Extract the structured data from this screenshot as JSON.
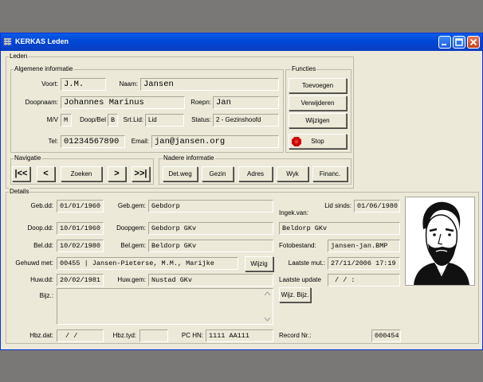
{
  "window": {
    "title": "KERKAS Leden"
  },
  "leden": {
    "group_label": "Leden",
    "algemeen": {
      "group_label": "Algemene informatie",
      "voort_label": "Voort:",
      "voort": "J.M.",
      "naam_label": "Naam:",
      "naam": "Jansen",
      "doopnaam_label": "Doopnaam:",
      "doopnaam": "Johannes Marinus",
      "roepn_label": "Roepn:",
      "roepn": "Jan",
      "mv_label": "M/V",
      "mv": "M",
      "doopbel_label": "Doop/Bel",
      "doopbel": "B",
      "srtlid_label": "Srt.Lid:",
      "srtlid": "Lid",
      "status_label": "Status:",
      "status": "2 - Gezinshoofd",
      "tel_label": "Tel:",
      "tel": "01234567890",
      "email_label": "Email:",
      "email": "jan@jansen.org"
    },
    "functies": {
      "group_label": "Functies",
      "toevoegen": "Toevoegen",
      "verwijderen": "Verwijderen",
      "wijzigen": "Wijzigen",
      "stop": "Stop"
    },
    "navigatie": {
      "group_label": "Navigatie",
      "first": "|<<",
      "prev": "<",
      "zoeken": "Zoeken",
      "next": ">",
      "last": ">>|"
    },
    "nadere": {
      "group_label": "Nadere informatie",
      "buttons": [
        "Det.weg",
        "Gezin",
        "Adres",
        "Wyk",
        "Financ."
      ]
    }
  },
  "details": {
    "group_label": "Details",
    "gebdd_label": "Geb.dd:",
    "gebdd": "01/01/1960",
    "gebgem_label": "Geb.gem:",
    "gebgem": "Gebdorp",
    "ingekvan_label": "Ingek.van:",
    "lidsinds_label": "Lid sinds:",
    "lidsinds": "01/06/1980",
    "doopdd_label": "Doop.dd:",
    "doopdd": "10/01/1960",
    "doopgem_label": "Doopgem:",
    "doopgem": "Gebdorp GKv",
    "ingekvan": "Beldorp GKv",
    "beldd_label": "Bel.dd:",
    "beldd": "10/02/1980",
    "belgem_label": "Bel.gem:",
    "belgem": "Beldorp GKv",
    "fotobestand_label": "Fotobestand:",
    "fotobestand": "jansen-jan.BMP",
    "gehuwd_label": "Gehuwd met:",
    "gehuwd": "00455 | Jansen-Pieterse, M.M., Marijke",
    "wijzig": "Wijzig",
    "laatstemut_label": "Laatste mut.:",
    "laatstemut": "27/11/2006 17:19",
    "huwdd_label": "Huw.dd:",
    "huwdd": "20/02/1981",
    "huwgem_label": "Huw.gem:",
    "huwgem": "Nustad GKv",
    "laatsteupdate_label": "Laatste update",
    "laatsteupdate": "/    /         :",
    "bijz_label": "Bijz.:",
    "wijzbijz": "Wijz. Bijz.",
    "hbzdat_label": "Hbz.dat:",
    "hbzdat": "/    /",
    "hbztyd_label": "Hbz.tyd:",
    "hbztyd": "",
    "pchn_label": "PC HN:",
    "pchn": "1111 AA111",
    "recordnr_label": "Record Nr.:",
    "recordnr": "000454"
  }
}
